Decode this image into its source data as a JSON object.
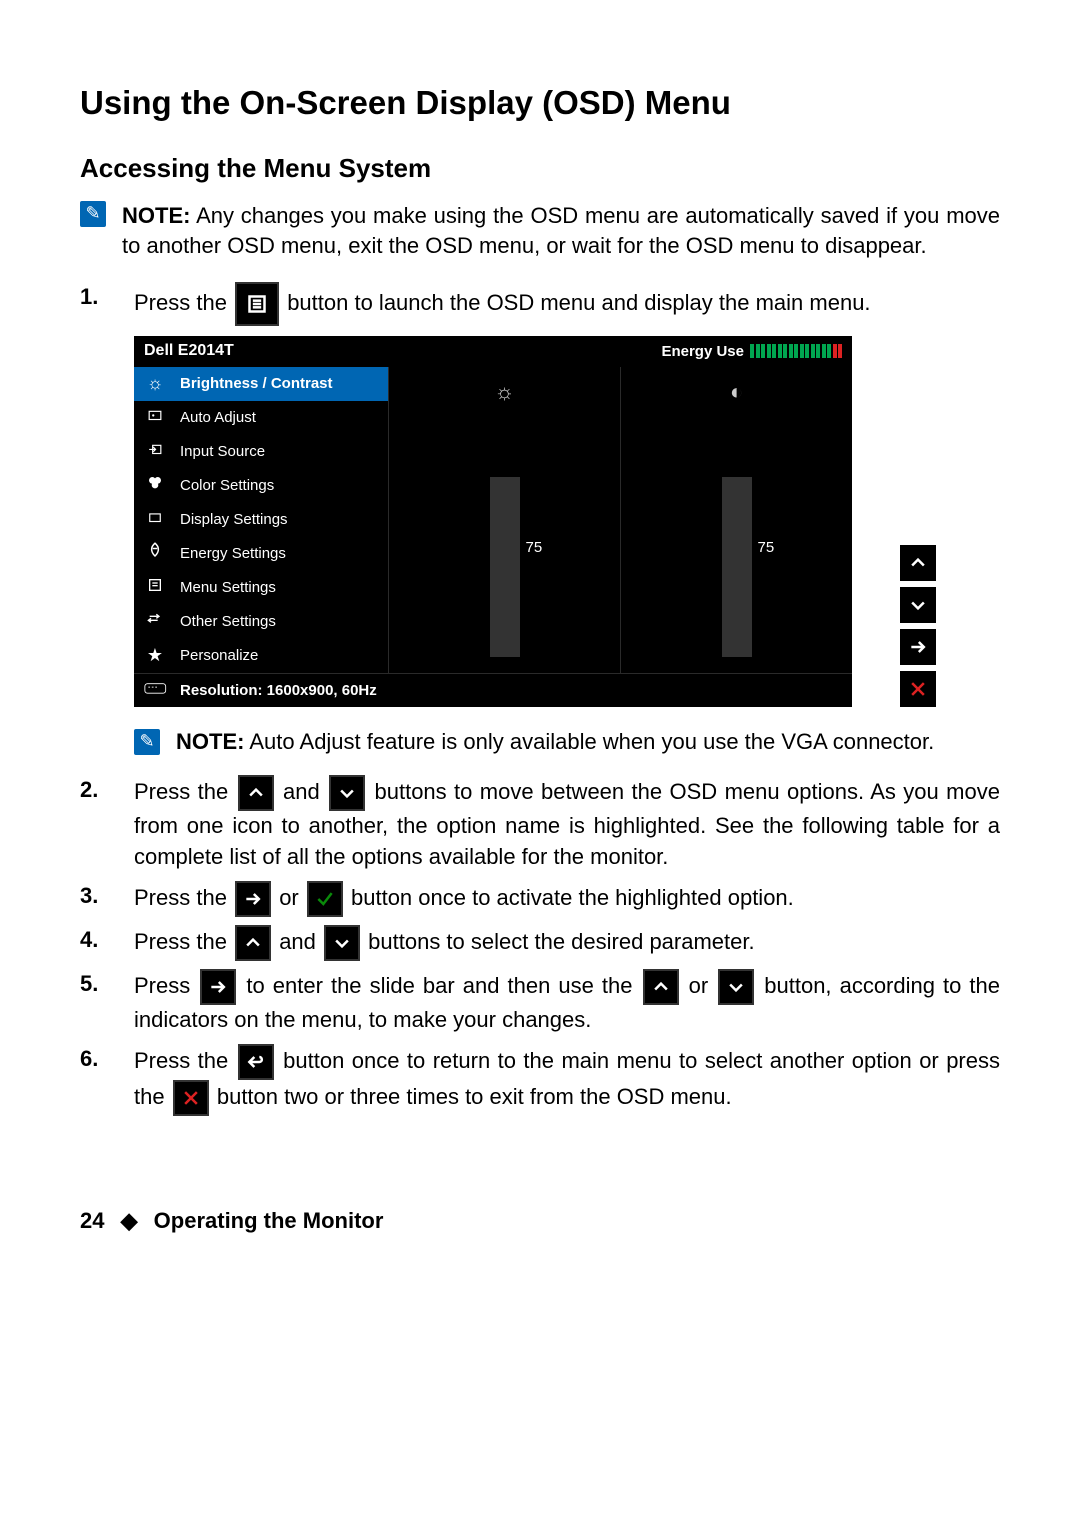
{
  "title": "Using the On-Screen Display (OSD) Menu",
  "subtitle": "Accessing the Menu System",
  "note1_label": "NOTE:",
  "note1": "Any changes you make using the OSD menu are automatically saved if you move to another OSD menu, exit the OSD menu, or wait for the OSD menu to disappear.",
  "steps": {
    "s1a": "Press the",
    "s1b": "button to launch the OSD menu and display the main menu.",
    "s2a": "Press the",
    "s2b": "and",
    "s2c": "buttons to move between the OSD menu options. As you move from one icon to another, the option name is highlighted. See the following table for a complete list of all the options available for the monitor.",
    "s3a": "Press the",
    "s3b": "or",
    "s3c": "button once to activate the highlighted option.",
    "s4a": "Press the",
    "s4b": "and",
    "s4c": "buttons to select the desired parameter.",
    "s5a": "Press",
    "s5b": "to enter the slide bar and then use the",
    "s5c": "or",
    "s5d": "button, according to the indicators on the menu, to make your changes.",
    "s6a": "Press the",
    "s6b": "button once to return to the main menu to select another option or press the",
    "s6c": "button two or three times to exit from the OSD menu."
  },
  "note2_label": "NOTE:",
  "note2": "Auto Adjust feature is only available when you use the VGA connector.",
  "osd": {
    "title": "Dell E2014T",
    "energy_label": "Energy Use",
    "menu": [
      "Brightness / Contrast",
      "Auto Adjust",
      "Input Source",
      "Color Settings",
      "Display Settings",
      "Energy Settings",
      "Menu Settings",
      "Other Settings",
      "Personalize"
    ],
    "brightness": "75",
    "contrast": "75",
    "resolution_label": "Resolution:",
    "resolution": "1600x900, 60Hz"
  },
  "footer_page": "24",
  "footer_section": "Operating the Monitor"
}
